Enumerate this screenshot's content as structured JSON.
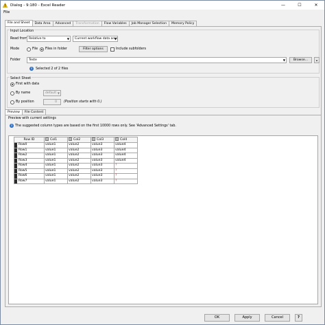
{
  "window": {
    "title": "Dialog - 9:180 - Excel Reader",
    "minimize": "—",
    "maximize": "☐",
    "close": "✕"
  },
  "menu": {
    "file": "File"
  },
  "tabs": [
    {
      "label": "File and Sheet",
      "state": "active"
    },
    {
      "label": "Data Area",
      "state": "normal"
    },
    {
      "label": "Advanced",
      "state": "normal"
    },
    {
      "label": "Transformation",
      "state": "disabled"
    },
    {
      "label": "Flow Variables",
      "state": "normal"
    },
    {
      "label": "Job Manager Selection",
      "state": "normal"
    },
    {
      "label": "Memory Policy",
      "state": "normal"
    }
  ],
  "input_location": {
    "title": "Input Location",
    "read_from_label": "Read from",
    "read_from_value": "Relative to",
    "relative_value": "Current workflow data area",
    "mode_label": "Mode",
    "mode_file": "File",
    "mode_folder": "Files in folder",
    "filter_options": "Filter options",
    "include_subfolders": "Include subfolders",
    "folder_label": "Folder",
    "folder_value": "Teste",
    "browse": "Browse...",
    "selection_info": "Selected 2 of 2 files"
  },
  "select_sheet": {
    "title": "Select Sheet",
    "first_with_data": "First with data",
    "by_name": "By name",
    "by_name_value": "default",
    "by_position": "By position",
    "by_position_value": "0",
    "position_hint": "(Position starts with 0.)"
  },
  "preview_tabs": [
    "Preview",
    "File Content"
  ],
  "preview": {
    "title": "Preview with current settings",
    "notice": "The suggested column types are based on the first 10000 rows only. See 'Advanced Settings' tab.",
    "columns": [
      "Row ID",
      "Col1",
      "Col2",
      "Col3",
      "Col4"
    ],
    "type_badge": "S",
    "rows": [
      [
        "Row0",
        "value1",
        "value2",
        "value3",
        "value4"
      ],
      [
        "Row1",
        "value1",
        "value2",
        "value3",
        "value4"
      ],
      [
        "Row2",
        "value1",
        "value2",
        "value3",
        "value4"
      ],
      [
        "Row3",
        "value1",
        "value2",
        "value3",
        "value4"
      ],
      [
        "Row4",
        "value1",
        "value2",
        "value3",
        "?"
      ],
      [
        "Row5",
        "value1",
        "value2",
        "value3",
        "?"
      ],
      [
        "Row6",
        "value1",
        "value2",
        "value3",
        "?"
      ],
      [
        "Row7",
        "value1",
        "value2",
        "value3",
        "?"
      ]
    ]
  },
  "footer": {
    "ok": "OK",
    "apply": "Apply",
    "cancel": "Cancel",
    "help": "?"
  },
  "colors": {
    "missing": "#e02020",
    "info": "#2f6fc4",
    "title_icon": "#f5c400"
  }
}
